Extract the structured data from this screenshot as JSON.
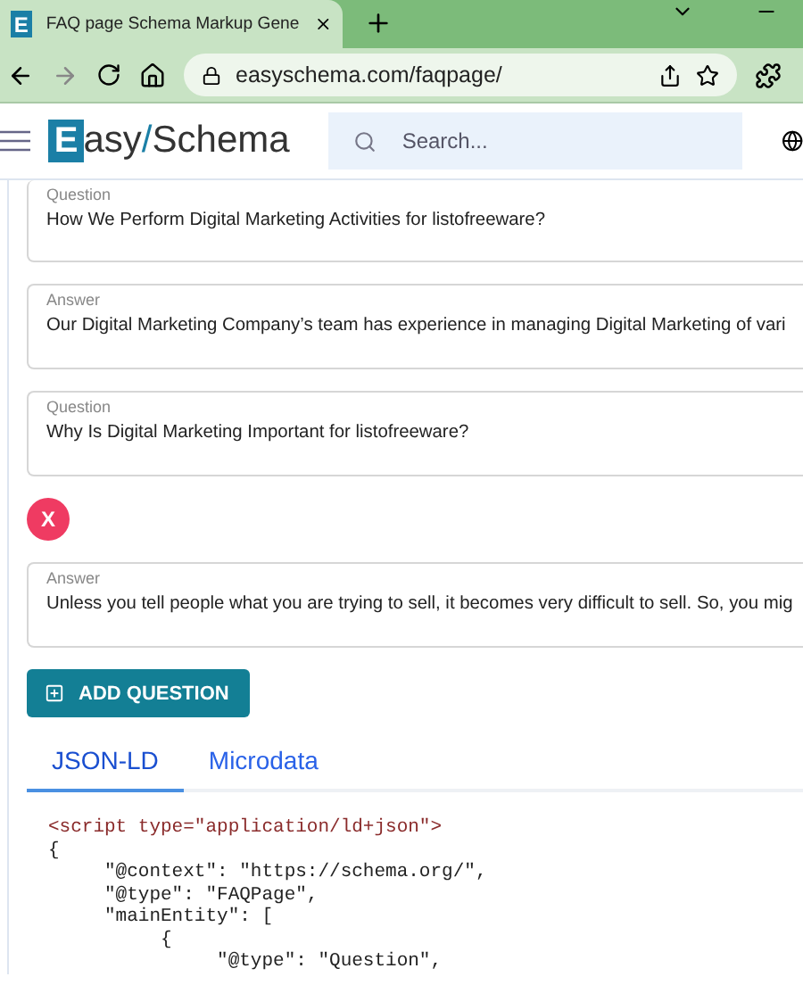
{
  "browser": {
    "tab_title": "FAQ page Schema Markup Gene",
    "url": "easyschema.com/faqpage/"
  },
  "header": {
    "favicon_letter": "E",
    "logo_letter": "E",
    "logo_text_1": "asy",
    "logo_slash": "/",
    "logo_text_2": "Schema",
    "search": {
      "placeholder": "Search..."
    }
  },
  "items": [
    {
      "kind": "field",
      "label": "Question",
      "value": "How We Perform Digital Marketing Activities for listofreeware?"
    },
    {
      "kind": "field",
      "label": "Answer",
      "value": "Our Digital Marketing Company’s team has experience in managing Digital Marketing of vari"
    },
    {
      "kind": "field",
      "label": "Question",
      "value": "Why Is Digital Marketing Important for listofreeware?"
    },
    {
      "kind": "remove",
      "label": "X"
    },
    {
      "kind": "field",
      "label": "Answer",
      "value": "Unless you tell people what you are trying to sell, it becomes very difficult to sell. So, you mig"
    }
  ],
  "add_button": "ADD QUESTION",
  "tabs": [
    {
      "label": "JSON-LD",
      "selected": true
    },
    {
      "label": "Microdata",
      "selected": false
    }
  ],
  "code": [
    "<script type=\"application/ld+json\">",
    "{",
    "     \"@context\": \"https://schema.org/\",",
    "     \"@type\": \"FAQPage\",",
    "     \"mainEntity\": [",
    "          {",
    "               \"@type\": \"Question\","
  ]
}
